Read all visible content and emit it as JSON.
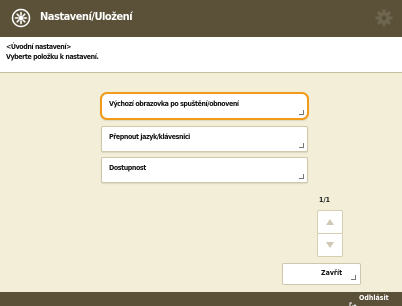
{
  "header": {
    "title": "Nastavení/Uložení"
  },
  "instruction": {
    "line1": "<Úvodní nastavení>",
    "line2": "Vyberte položku k nastavení."
  },
  "options": [
    {
      "label": "Výchozí obrazovka po spuštění/obnovení"
    },
    {
      "label": "Přepnout jazyk/klávesnici"
    },
    {
      "label": "Dostupnost"
    }
  ],
  "pagination": {
    "indicator": "1/1"
  },
  "footer": {
    "close_label": "Zavřít"
  },
  "status": {
    "text": "Odhlásit"
  },
  "colors": {
    "title_bar": "#5b5139",
    "background": "#f2eed8",
    "highlight": "#f29a1a"
  }
}
